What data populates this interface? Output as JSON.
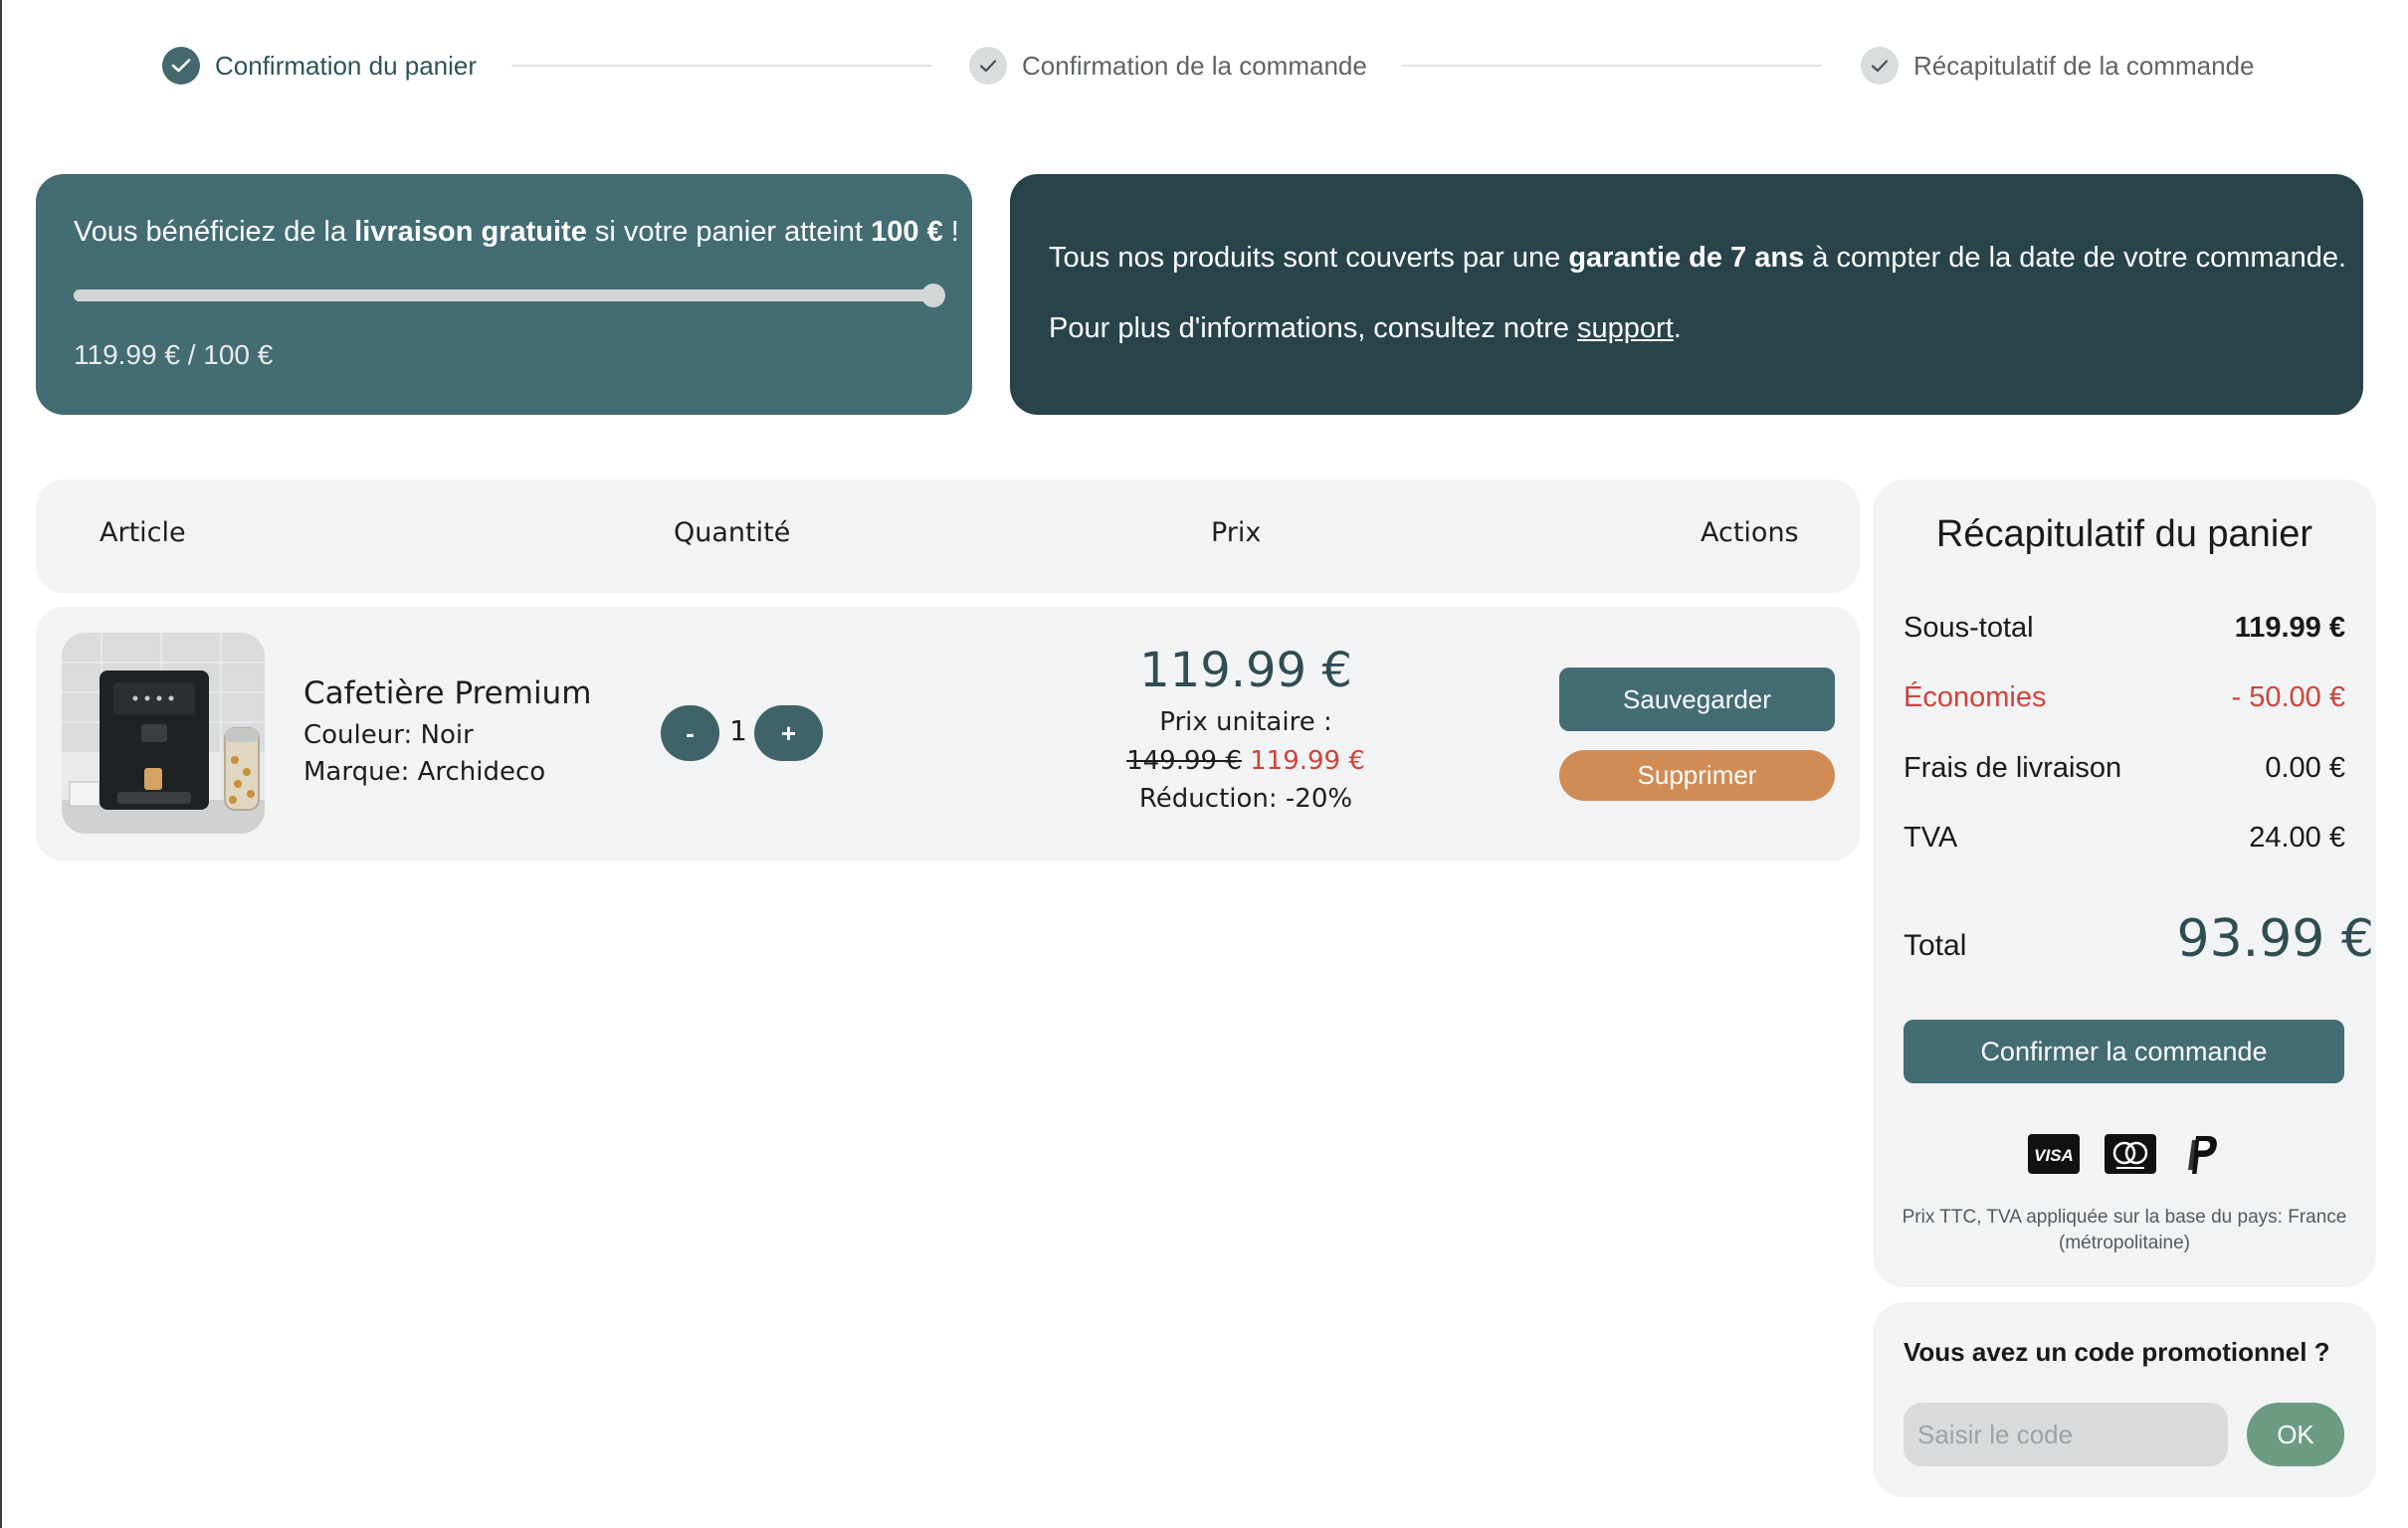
{
  "stepper": {
    "steps": [
      {
        "label": "Confirmation du panier",
        "state": "active"
      },
      {
        "label": "Confirmation de la commande",
        "state": "inactive"
      },
      {
        "label": "Récapitulatif de la commande",
        "state": "inactive"
      }
    ],
    "check_icon": "check-icon"
  },
  "shipping_banner": {
    "text_before": "Vous bénéficiez de la ",
    "text_bold_1": "livraison gratuite",
    "text_middle": " si votre panier atteint ",
    "text_bold_2": "100 €",
    "text_after": " !",
    "progress_fraction": 1.0,
    "amount_text": "119.99 € / 100 €"
  },
  "warranty_banner": {
    "line1_before": "Tous nos produits sont couverts par une ",
    "line1_bold": "garantie de 7 ans",
    "line1_after": " à compter de la date de votre commande.",
    "line2_before": "Pour plus d'informations, consultez notre ",
    "line2_link": "support",
    "line2_after": "."
  },
  "cart_table": {
    "headers": [
      "Article",
      "Quantité",
      "Prix",
      "Actions"
    ],
    "items": [
      {
        "name": "Cafetière Premium",
        "color": "Couleur: Noir",
        "brand": "Marque: Archideco",
        "image_icon": "coffee-machine-image",
        "quantity": "1",
        "qty_minus": "-",
        "qty_plus": "+",
        "price": "119.99 €",
        "unit_price_label": "Prix unitaire :",
        "old_price": "149.99 €",
        "new_price": "119.99 €",
        "discount": "Réduction: -20%",
        "save_label": "Sauvegarder",
        "delete_label": "Supprimer"
      }
    ]
  },
  "summary": {
    "title": "Récapitulatif du panier",
    "rows": [
      {
        "label": "Sous-total",
        "value": "119.99 €"
      },
      {
        "label": "Économies",
        "value": "- 50.00 €"
      },
      {
        "label": "Frais de livraison",
        "value": "0.00 €"
      },
      {
        "label": "TVA",
        "value": "24.00 €"
      }
    ],
    "total_label": "Total",
    "total_value": "93.99 €",
    "confirm_label": "Confirmer la commande",
    "payment_icons": [
      "visa-icon",
      "mastercard-icon",
      "paypal-icon"
    ],
    "visa_text": "VISA",
    "vat_note": "Prix TTC, TVA appliquée sur la base du pays: France (métropolitaine)"
  },
  "promo": {
    "title": "Vous avez un code promotionnel ?",
    "placeholder": "Saisir le code",
    "button_label": "OK"
  },
  "colors": {
    "primary": "#436c73",
    "dark": "#28444a",
    "danger": "#d0423a",
    "delete": "#d18c56",
    "ok": "#6b9b83"
  }
}
